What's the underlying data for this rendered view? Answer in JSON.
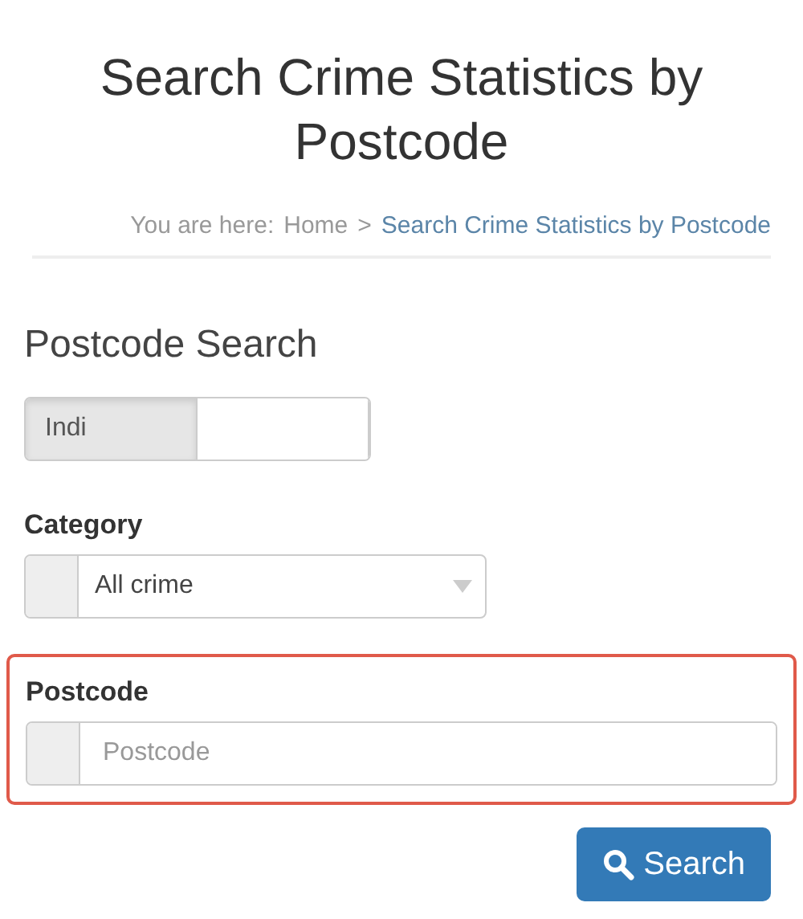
{
  "title": "Search Crime Statistics by Postcode",
  "breadcrumb": {
    "prefix": "You are here:",
    "items": [
      {
        "label": "Home",
        "current": false
      },
      {
        "label": "Search Crime Statistics by Postcode",
        "current": true
      }
    ],
    "separator": ">"
  },
  "section_title": "Postcode Search",
  "mode_toggle": [
    {
      "label": "Indi",
      "selected": true
    },
    {
      "selected": false
    }
  ],
  "category": {
    "label": "Category",
    "value": "All crime"
  },
  "postcode": {
    "label": "Postcode",
    "placeholder": "Postcode",
    "error": true
  },
  "search_button": "Search"
}
